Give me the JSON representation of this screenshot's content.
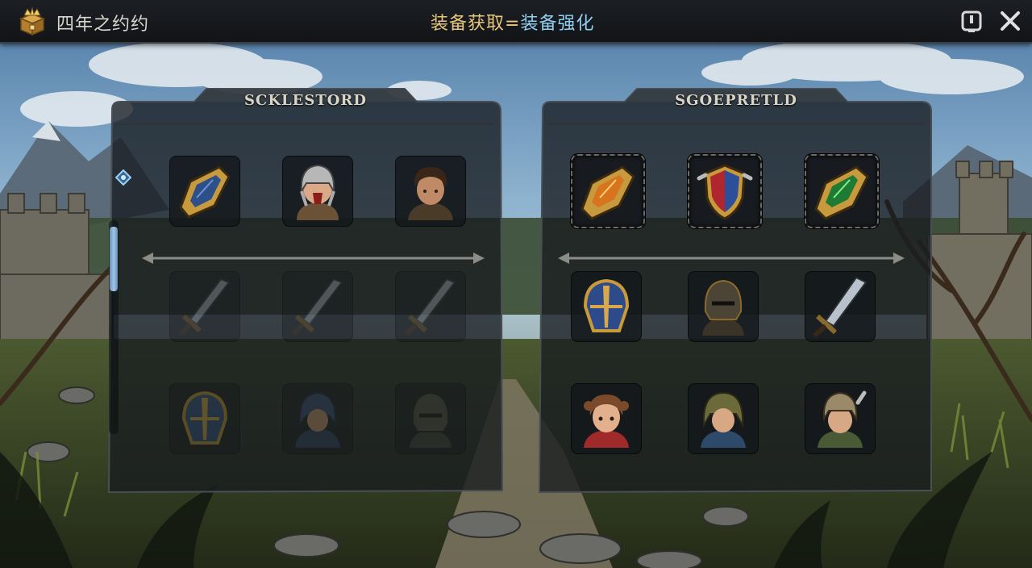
{
  "app": {
    "title": "四年之约约",
    "logo_icon": "treasure-chest-icon"
  },
  "header": {
    "title_left": "装备获取",
    "separator": "=",
    "title_right": "装备强化",
    "info_icon": "info-icon",
    "close_icon": "close-icon",
    "accent_gold": "#e8c77c",
    "accent_blue": "#8fd0f2"
  },
  "panels": {
    "left": {
      "title": "SCKLESTORD",
      "slots": [
        {
          "icon": "gauntlet-blue-icon",
          "state": "normal"
        },
        {
          "icon": "knight-helmet-portrait-icon",
          "state": "normal"
        },
        {
          "icon": "hero-portrait-icon",
          "state": "normal"
        },
        {
          "icon": "sword-icon",
          "state": "faded"
        },
        {
          "icon": "sword-icon",
          "state": "faded"
        },
        {
          "icon": "sword-icon",
          "state": "faded"
        },
        {
          "icon": "blue-helmet-icon",
          "state": "faded"
        },
        {
          "icon": "hooded-knight-icon",
          "state": "faded"
        },
        {
          "icon": "dark-helmet-icon",
          "state": "faded"
        }
      ]
    },
    "right": {
      "title": "SGOEPRETLD",
      "slots": [
        {
          "icon": "gauntlet-orange-icon",
          "state": "active"
        },
        {
          "icon": "crest-shield-icon",
          "state": "active"
        },
        {
          "icon": "gauntlet-green-icon",
          "state": "active"
        },
        {
          "icon": "blue-helmet-icon",
          "state": "normal"
        },
        {
          "icon": "dark-helmet-icon",
          "state": "normal"
        },
        {
          "icon": "sword-icon",
          "state": "normal"
        },
        {
          "icon": "girl-portrait-icon",
          "state": "normal"
        },
        {
          "icon": "hooded-hero-icon",
          "state": "normal"
        },
        {
          "icon": "helmet-hero-icon",
          "state": "normal"
        }
      ]
    }
  }
}
